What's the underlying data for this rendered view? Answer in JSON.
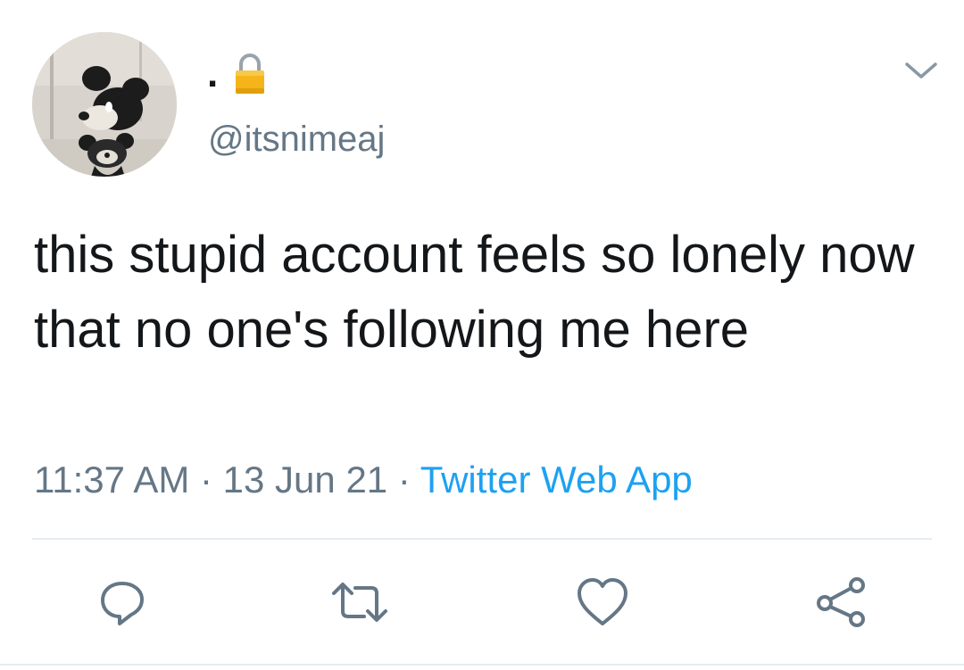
{
  "author": {
    "display_name": ".",
    "handle": "@itsnimeaj",
    "protected_icon": "lock-icon",
    "avatar_icon": "cartoon-mouse-avatar"
  },
  "tweet": {
    "text": "this stupid account feels so lonely now that no one's following me here",
    "time": "11:37 AM",
    "separator": " · ",
    "date": "13 Jun 21",
    "source": "Twitter Web App"
  },
  "menu": {
    "icon": "chevron-down-icon"
  },
  "actions": [
    {
      "name": "reply",
      "icon": "comment-icon"
    },
    {
      "name": "retweet",
      "icon": "retweet-icon"
    },
    {
      "name": "like",
      "icon": "heart-icon"
    },
    {
      "name": "share",
      "icon": "share-icon"
    }
  ],
  "colors": {
    "text": "#14171a",
    "secondary": "#657786",
    "link": "#1da1f2",
    "divider": "#e6ecf0",
    "lock": "#f5b51a"
  }
}
